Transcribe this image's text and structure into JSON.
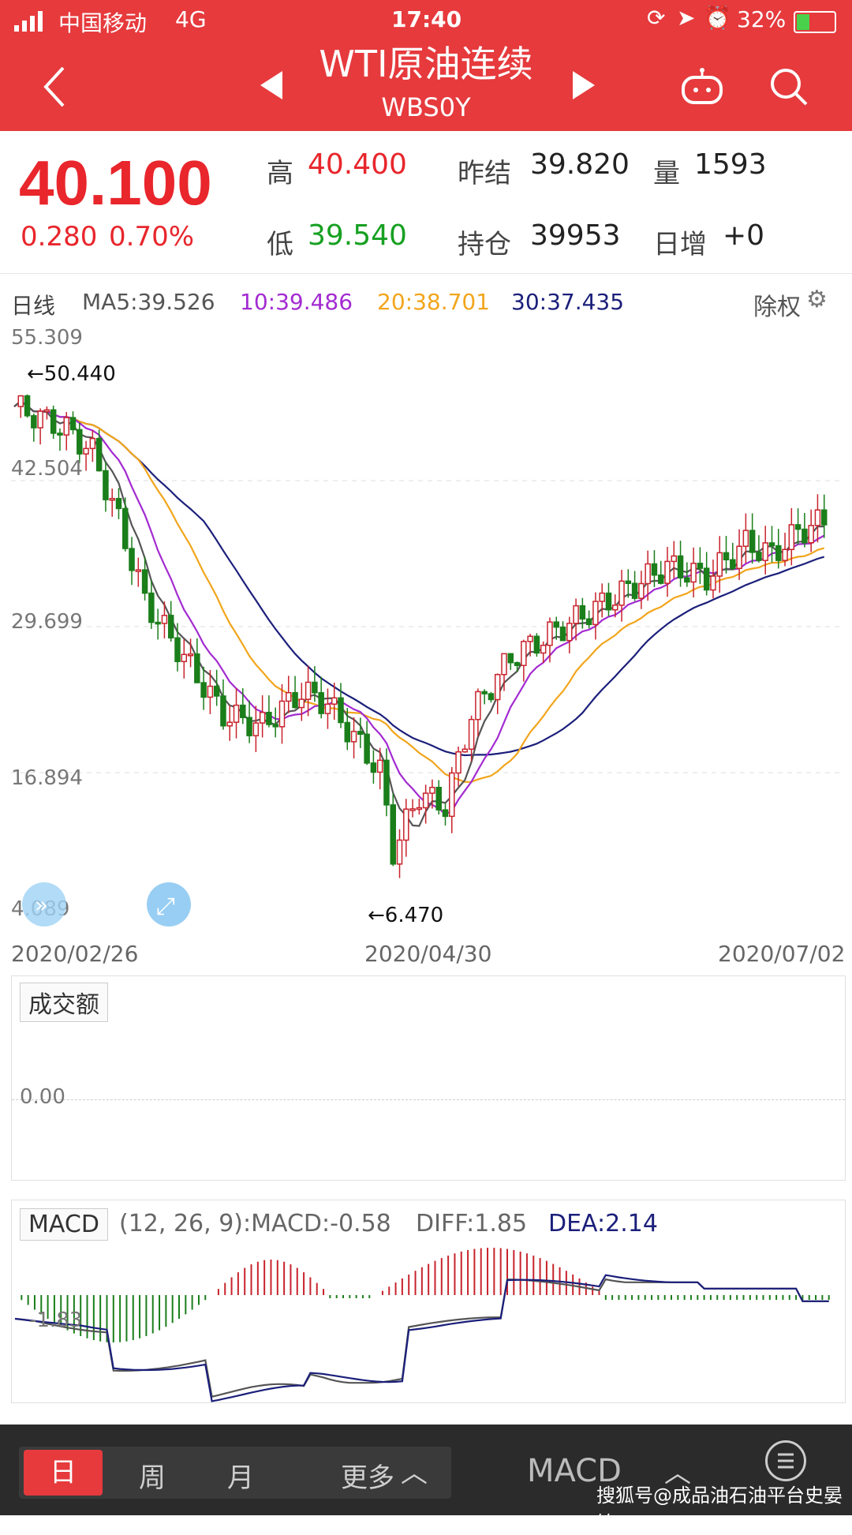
{
  "status": {
    "carrier": "中国移动",
    "network": "4G",
    "time": "17:40",
    "battery": "32%"
  },
  "nav": {
    "title": "WTI原油连续",
    "code": "WBS0Y"
  },
  "quote": {
    "price": "40.100",
    "change": "0.280",
    "change_pct": "0.70%",
    "high_label": "高",
    "high": "40.400",
    "low_label": "低",
    "low": "39.540",
    "prev_label": "昨结",
    "prev": "39.820",
    "vol_label": "量",
    "vol": "1593",
    "oi_label": "持仓",
    "oi": "39953",
    "daily_label": "日增",
    "daily": "+0"
  },
  "ma_row": {
    "period": "日线",
    "ma5": "MA5:39.526",
    "ma10": "10:39.486",
    "ma20": "20:38.701",
    "ma30": "30:37.435",
    "adjust": "除权"
  },
  "main": {
    "y_labels": [
      "55.309",
      "42.504",
      "29.699",
      "16.894",
      "4.089"
    ],
    "max_label": "←50.440",
    "min_label": "←6.470"
  },
  "dates": {
    "d1": "2020/02/26",
    "d2": "2020/04/30",
    "d3": "2020/07/02"
  },
  "volume": {
    "tag": "成交额",
    "zero": "0.00"
  },
  "macd": {
    "tag": "MACD",
    "info": "(12, 26, 9):MACD:-0.58",
    "diff": "DIFF:1.85",
    "dea": "DEA:2.14",
    "y_label": "-1.83"
  },
  "bottom": {
    "tab_day": "日",
    "tab_week": "周",
    "tab_month": "月",
    "more": "更多",
    "indicator": "MACD",
    "watermark": "搜狐号@成品油石油平台史晏铭"
  },
  "colors": {
    "accent": "#e63a3d",
    "up": "#c8232c",
    "down": "#1a7e1a",
    "ma5": "#555555",
    "ma10": "#a32bd1",
    "ma20": "#f2a51c",
    "ma30": "#1b1f7a"
  }
}
